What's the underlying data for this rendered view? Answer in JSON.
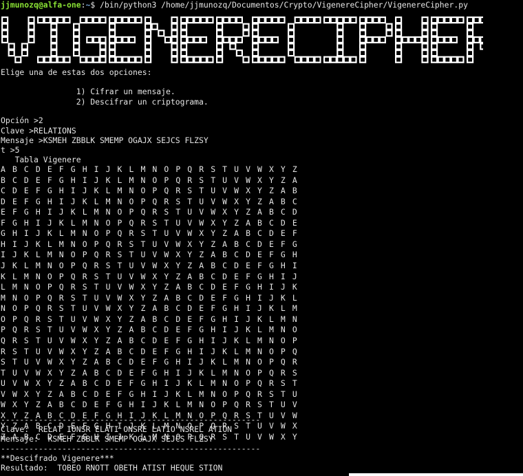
{
  "prompt": {
    "user_host": "jjmunozq@alfa-one",
    "colon": ":",
    "path": "~",
    "symbol": "$",
    "command": " /bin/python3 /home/jjmunozq/Documentos/Crypto/VigenereCipher/VigenereCipher.py"
  },
  "banner": {
    "text": "VIGENERECIPHER"
  },
  "menu": {
    "intro": "Elige una de estas dos opciones:",
    "option1": "                1) Cifrar un mensaje.",
    "option2": "                2) Descifrar un criptograma."
  },
  "inputs": {
    "opcion": "Opción >2",
    "clave": "Clave >RELATIONS",
    "mensaje": "Mensaje >KSMEH ZBBLK SMEMP OGAJX SEJCS FLZSY",
    "t": "t >5"
  },
  "table": {
    "title": "   Tabla Vigenere",
    "rows": [
      "ABCDEFGHIJKLMNOPQRSTUVWXYZ",
      "BCDEFGHIJKLMNOPQRSTUVWXYZA",
      "CDEFGHIJKLMNOPQRSTUVWXYZAB",
      "DEFGHIJKLMNOPQRSTUVWXYZABC",
      "EFGHIJKLMNOPQRSTUVWXYZABCD",
      "FGHIJKLMNOPQRSTUVWXYZABCDE",
      "GHIJKLMNOPQRSTUVWXYZABCDEF",
      "HIJKLMNOPQRSTUVWXYZABCDEFG",
      "IJKLMNOPQRSTUVWXYZABCDEFGH",
      "JKLMNOPQRSTUVWXYZABCDEFGHI",
      "KLMNOPQRSTUVWXYZABCDEFGHIJ",
      "LMNOPQRSTUVWXYZABCDEFGHIJK",
      "MNOPQRSTUVWXYZABCDEFGHIJKL",
      "NOPQRSTUVWXYZABCDEFGHIJKLM",
      "OPQRSTUVWXYZABCDEFGHIJKLMN",
      "PQRSTUVWXYZABCDEFGHIJKLMNO",
      "QRSTUVWXYZABCDEFGHIJKLMNOP",
      "RSTUVWXYZABCDEFGHIJKLMNOPQ",
      "STUVWXYZABCDEFGHIJKLMNOPQR",
      "TUVWXYZABCDEFGHIJKLMNOPQRS",
      "UVWXYZABCDEFGHIJKLMNOPQRST",
      "VWXYZABCDEFGHIJKLMNOPQRSTU",
      "WXYZABCDEFGHIJKLMNOPQRSTUV",
      "XYZABCDEFGHIJKLMNOPQRSTUVW",
      "YZABCDEFGHIJKLMNOPQRSTUVWX",
      "ZABCDEFGHIJKLMNOPQRSTUVWXY"
    ]
  },
  "separator": "-------------------------------------------------------",
  "summary": {
    "clave": "Clave:  RELAT IONSR ELATI ONSRE LATIO NSREL ATION",
    "mensaje": "Mensaje:  KSMEH ZBBLK SMEMP OGAJX SEJCS FLZSY"
  },
  "result": {
    "header": "**Descifrado Vigenere***",
    "resultado": "Resultado:  TOBEO RNOTT OBETH ATIST HEQUE STION"
  },
  "colors": {
    "background": "#000000",
    "text": "#e6e6e6",
    "prompt_user": "#8ae234",
    "prompt_path": "#729fcf"
  }
}
